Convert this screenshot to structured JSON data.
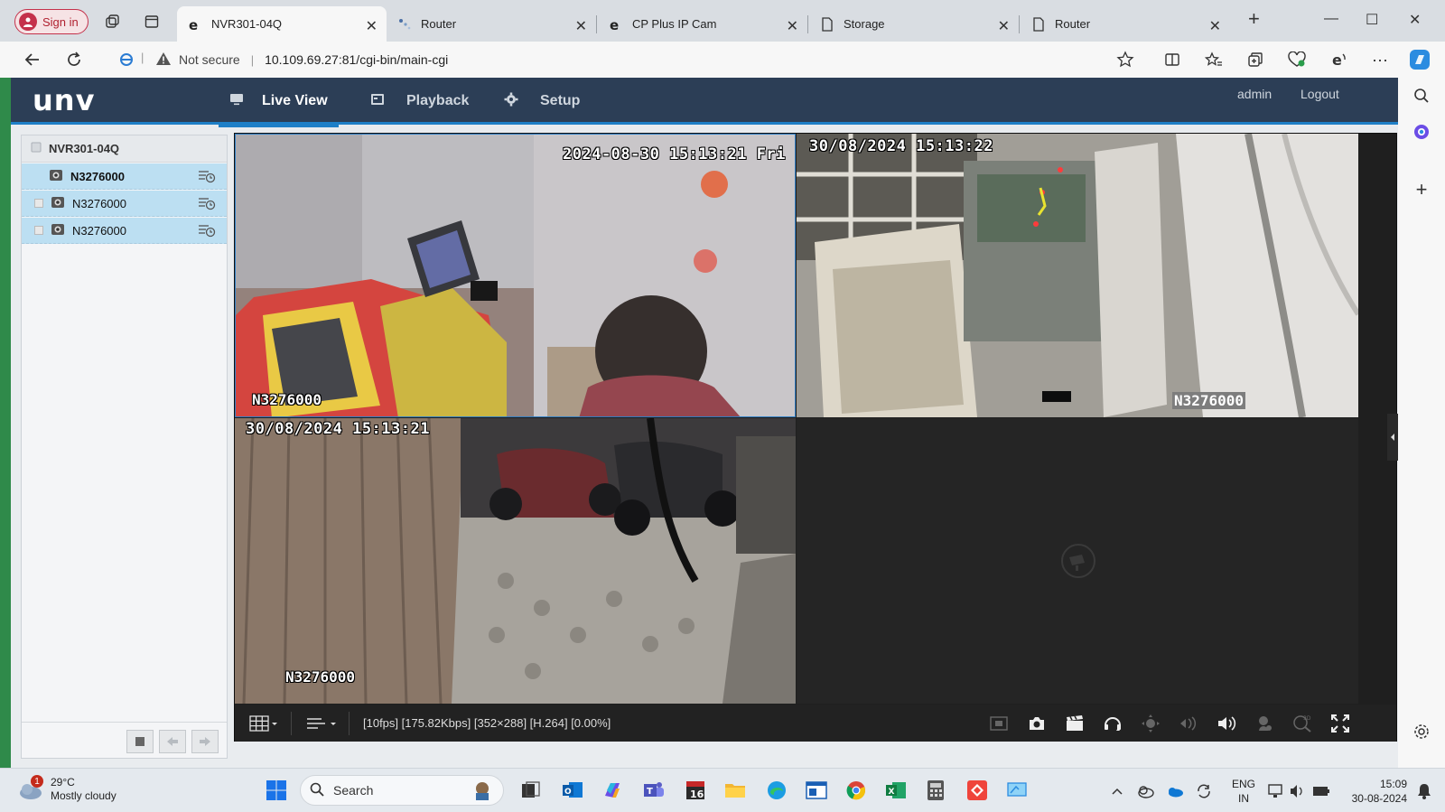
{
  "browser": {
    "signin_label": "Sign in",
    "tabs": [
      {
        "title": "NVR301-04Q",
        "active": true
      },
      {
        "title": "Router",
        "active": false
      },
      {
        "title": "CP Plus IP Cam",
        "active": false
      },
      {
        "title": "Storage",
        "active": false
      },
      {
        "title": "Router",
        "active": false
      }
    ],
    "security_label": "Not secure",
    "url": "10.109.69.27:81/cgi-bin/main-cgi"
  },
  "app": {
    "logo": "unv",
    "menu": [
      {
        "label": "Live View",
        "icon": "monitor-icon",
        "active": true
      },
      {
        "label": "Playback",
        "icon": "film-icon",
        "active": false
      },
      {
        "label": "Setup",
        "icon": "gear-icon",
        "active": false
      }
    ],
    "user": "admin",
    "logout": "Logout",
    "device_tree": {
      "root": "NVR301-04Q",
      "channels": [
        {
          "name": "N3276000",
          "selected": true
        },
        {
          "name": "N3276000",
          "selected": false
        },
        {
          "name": "N3276000",
          "selected": false
        }
      ]
    },
    "panes": [
      {
        "timestamp": "2024-08-30 15:13:21 Fri",
        "camera_name": "N3276000"
      },
      {
        "timestamp": "30/08/2024 15:13:22",
        "camera_name": "N3276000"
      },
      {
        "timestamp": "30/08/2024 15:13:21",
        "camera_name": "N3276000"
      },
      {
        "timestamp": "",
        "camera_name": ""
      }
    ],
    "stream_info": "[10fps] [175.82Kbps] [352×288] [H.264] [0.00%]"
  },
  "taskbar": {
    "weather_temp": "29°C",
    "weather_desc": "Mostly cloudy",
    "weather_badge": "1",
    "search_placeholder": "Search",
    "lang_top": "ENG",
    "lang_bottom": "IN",
    "time": "15:09",
    "date": "30-08-2024"
  },
  "colors": {
    "header_bg": "#2c3e56",
    "accent": "#1e7fc7",
    "tree_selected": "#bcdff2",
    "viewer_bg": "#1f1f1f"
  }
}
